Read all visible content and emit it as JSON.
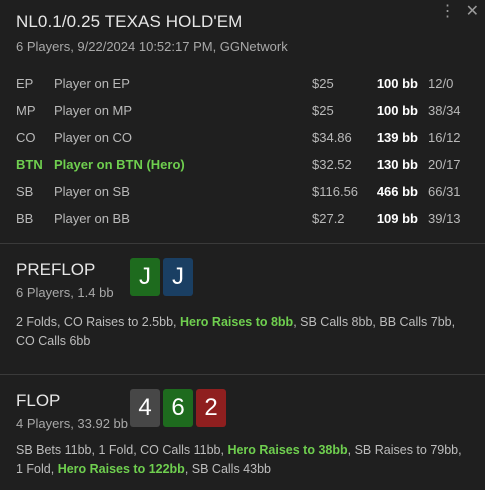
{
  "window": {
    "menu_icon": "⋮",
    "close_icon": "✕"
  },
  "hand": {
    "title": "NL0.1/0.25 TEXAS HOLD'EM",
    "subtitle": "6 Players, 9/22/2024 10:52:17 PM, GGNetwork"
  },
  "players": [
    {
      "pos": "EP",
      "name": "Player on EP",
      "stack": "$25",
      "bb": "100 bb",
      "stat": "12/0",
      "hero": false
    },
    {
      "pos": "MP",
      "name": "Player on MP",
      "stack": "$25",
      "bb": "100 bb",
      "stat": "38/34",
      "hero": false
    },
    {
      "pos": "CO",
      "name": "Player on CO",
      "stack": "$34.86",
      "bb": "139 bb",
      "stat": "16/12",
      "hero": false
    },
    {
      "pos": "BTN",
      "name": "Player on BTN (Hero)",
      "stack": "$32.52",
      "bb": "130 bb",
      "stat": "20/17",
      "hero": true
    },
    {
      "pos": "SB",
      "name": "Player on SB",
      "stack": "$116.56",
      "bb": "466 bb",
      "stat": "66/31",
      "hero": false
    },
    {
      "pos": "BB",
      "name": "Player on BB",
      "stack": "$27.2",
      "bb": "109 bb",
      "stat": "39/13",
      "hero": false
    }
  ],
  "colors": {
    "spade_black": "#474747",
    "club_green": "#1e6b1e",
    "diamond_blue": "#1a3f63",
    "heart_red": "#8f1f1f",
    "hero_green": "#6fcf4f"
  },
  "streets": [
    {
      "id": "preflop",
      "name": "PREFLOP",
      "info": "6 Players, 1.4 bb",
      "cards": [
        {
          "rank": "J",
          "color": "#1e6b1e"
        },
        {
          "rank": "J",
          "color": "#1a3f63"
        }
      ],
      "actions": [
        {
          "text": "2 Folds, CO Raises to 2.5bb, ",
          "hero": false
        },
        {
          "text": "Hero Raises to 8bb",
          "hero": true
        },
        {
          "text": ", SB Calls 8bb, BB Calls 7bb, CO Calls 6bb",
          "hero": false
        }
      ]
    },
    {
      "id": "flop",
      "name": "FLOP",
      "info": "4 Players, 33.92 bb",
      "cards": [
        {
          "rank": "4",
          "color": "#474747"
        },
        {
          "rank": "6",
          "color": "#1e6b1e"
        },
        {
          "rank": "2",
          "color": "#8f1f1f"
        }
      ],
      "actions": [
        {
          "text": "SB Bets 11bb, 1 Fold, CO Calls 11bb, ",
          "hero": false
        },
        {
          "text": "Hero Raises to 38bb",
          "hero": true
        },
        {
          "text": ", SB Raises to 79bb, 1 Fold, ",
          "hero": false
        },
        {
          "text": "Hero Raises to 122bb",
          "hero": true
        },
        {
          "text": ", SB Calls 43bb",
          "hero": false
        }
      ]
    }
  ]
}
